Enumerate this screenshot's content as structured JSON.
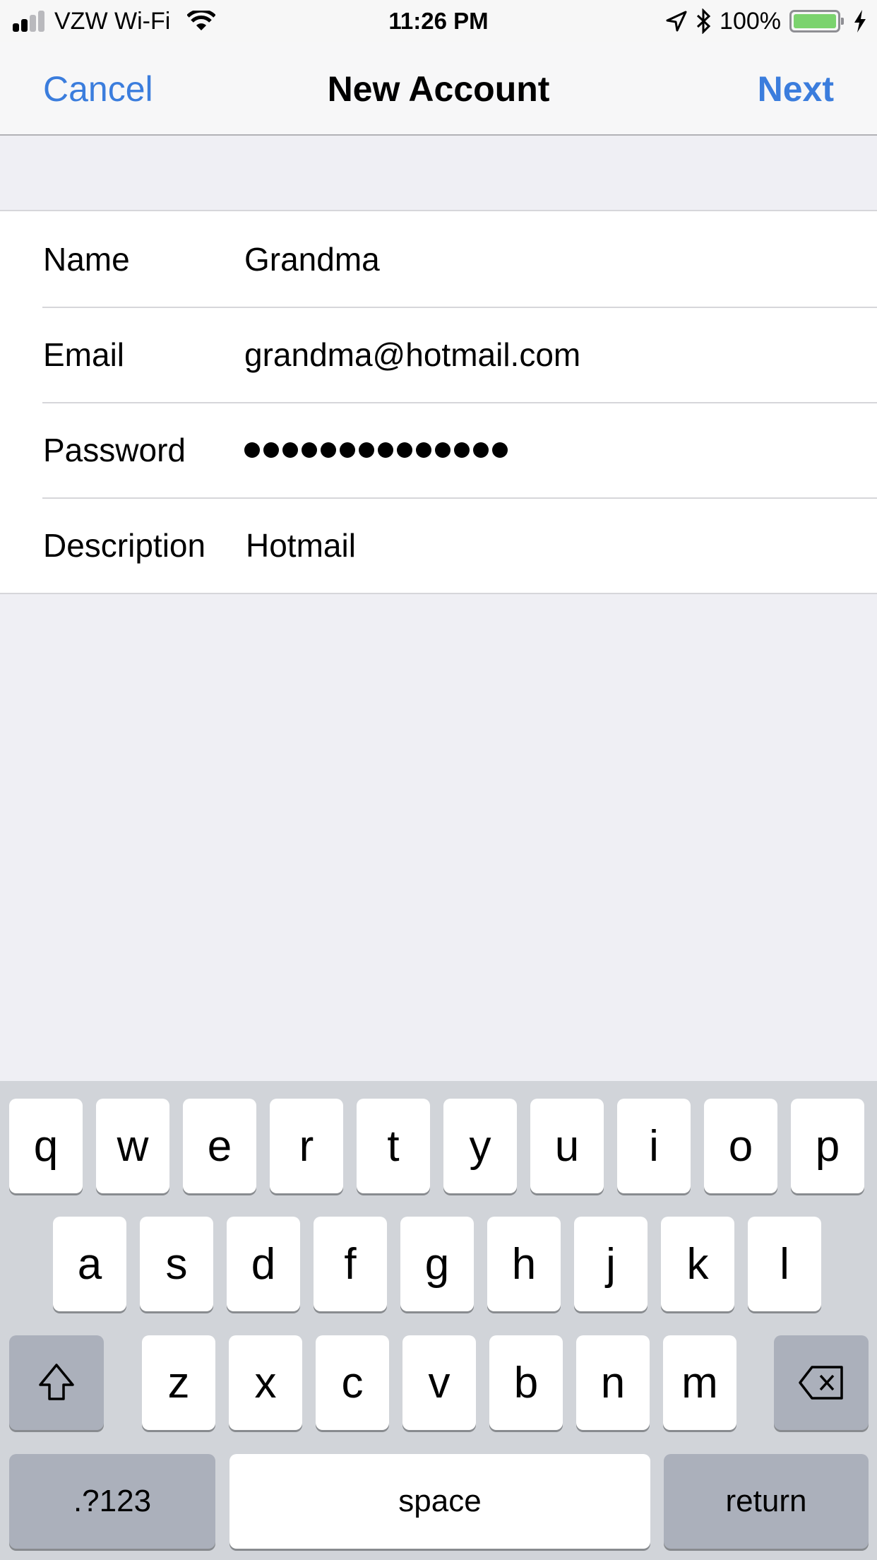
{
  "status_bar": {
    "carrier": "VZW Wi-Fi",
    "signal_bars": 2,
    "signal_total": 4,
    "time": "11:26 PM",
    "battery_percent": "100%",
    "battery_level": 1.0,
    "icons": [
      "signal-icon",
      "wifi-icon",
      "location-icon",
      "bluetooth-icon",
      "battery-icon",
      "charging-icon"
    ]
  },
  "nav": {
    "cancel_label": "Cancel",
    "title": "New Account",
    "next_label": "Next",
    "accent_color": "#3b7ddd"
  },
  "form": {
    "fields": [
      {
        "label": "Name",
        "value": "Grandma"
      },
      {
        "label": "Email",
        "value": "grandma@hotmail.com"
      },
      {
        "label": "Password",
        "value": "••••••••••••••",
        "masked_length": 14
      },
      {
        "label": "Description",
        "value": "Hotmail"
      }
    ]
  },
  "keyboard": {
    "row1": [
      "q",
      "w",
      "e",
      "r",
      "t",
      "y",
      "u",
      "i",
      "o",
      "p"
    ],
    "row2": [
      "a",
      "s",
      "d",
      "f",
      "g",
      "h",
      "j",
      "k",
      "l"
    ],
    "row3": [
      "z",
      "x",
      "c",
      "v",
      "b",
      "n",
      "m"
    ],
    "shift_icon": "shift-icon",
    "delete_icon": "backspace-icon",
    "numbers_label": ".?123",
    "space_label": "space",
    "return_label": "return"
  }
}
